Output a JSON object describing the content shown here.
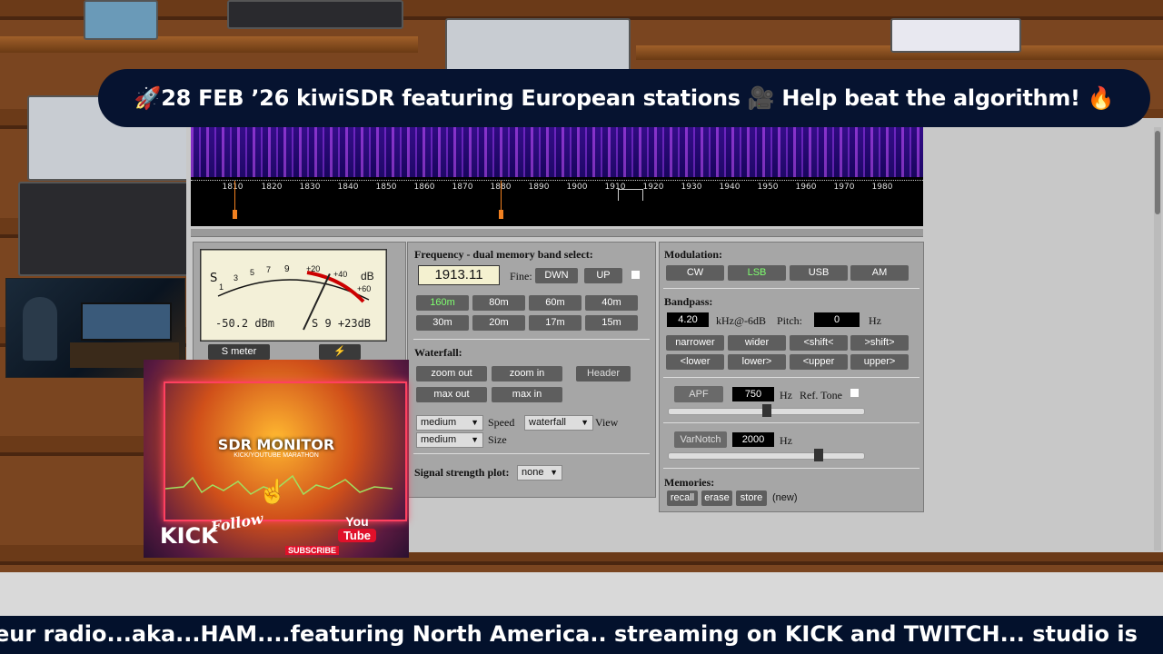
{
  "banner": {
    "text": "🚀28 FEB ’26 kiwiSDR featuring European stations 🎥 Help beat the algorithm! 🔥"
  },
  "ticker": {
    "text": "eur radio...aka...HAM....featuring North America.. streaming on KICK and TWITCH... studio is"
  },
  "scale": {
    "ticks": [
      "1810",
      "1820",
      "1830",
      "1840",
      "1850",
      "1860",
      "1870",
      "1880",
      "1890",
      "1900",
      "1910",
      "1920",
      "1930",
      "1940",
      "1950",
      "1960",
      "1970",
      "1980"
    ]
  },
  "meter": {
    "labels": [
      "S",
      "1",
      "3",
      "5",
      "7",
      "9",
      "+20",
      "+40",
      "dB",
      "+60"
    ],
    "dbm": "-50.2 dBm",
    "s_reading": "S 9 +23dB",
    "s_meter_button": "S meter",
    "level_fraction": 0.78
  },
  "frequency": {
    "title": "Frequency - dual memory band select:",
    "value": "1913.11",
    "fine_label": "Fine:",
    "down": "DWN",
    "up": "UP",
    "bands": [
      "160m",
      "80m",
      "60m",
      "40m",
      "30m",
      "20m",
      "17m",
      "15m"
    ],
    "selected_band": "160m"
  },
  "waterfall": {
    "title": "Waterfall:",
    "buttons": [
      "zoom out",
      "zoom in",
      "Header",
      "max out",
      "max in"
    ],
    "speed_value": "medium",
    "speed_label": "Speed",
    "view_value": "waterfall",
    "view_label": "View",
    "size_value": "medium",
    "size_label": "Size",
    "signal_plot_label": "Signal strength plot:",
    "signal_plot_value": "none"
  },
  "modulation": {
    "title": "Modulation:",
    "modes": [
      "CW",
      "LSB",
      "USB",
      "AM"
    ],
    "selected": "LSB"
  },
  "bandpass": {
    "title": "Bandpass:",
    "width_value": "4.20",
    "width_label": "kHz@-6dB",
    "pitch_label": "Pitch:",
    "pitch_value": "0",
    "pitch_unit": "Hz",
    "buttons_row1": [
      "narrower",
      "wider",
      "<shift<",
      ">shift>"
    ],
    "buttons_row2": [
      "<lower",
      "lower>",
      "<upper",
      "upper>"
    ]
  },
  "apf": {
    "button": "APF",
    "value": "750",
    "unit": "Hz",
    "ref_tone_label": "Ref. Tone",
    "slider_fraction": 0.5
  },
  "varnotch": {
    "button": "VarNotch",
    "value": "2000",
    "unit": "Hz",
    "slider_fraction": 0.78
  },
  "memories": {
    "title": "Memories:",
    "buttons": [
      "recall",
      "erase",
      "store"
    ],
    "status": "(new)"
  },
  "promo": {
    "title": "SDR MONITOR",
    "subtitle": "KICK/YOUTUBE MARATHON",
    "kick": "KICK",
    "follow": "Follow",
    "subscribe": "SUBSCRIBE",
    "youtube_you": "You",
    "youtube_tube": "Tube"
  }
}
